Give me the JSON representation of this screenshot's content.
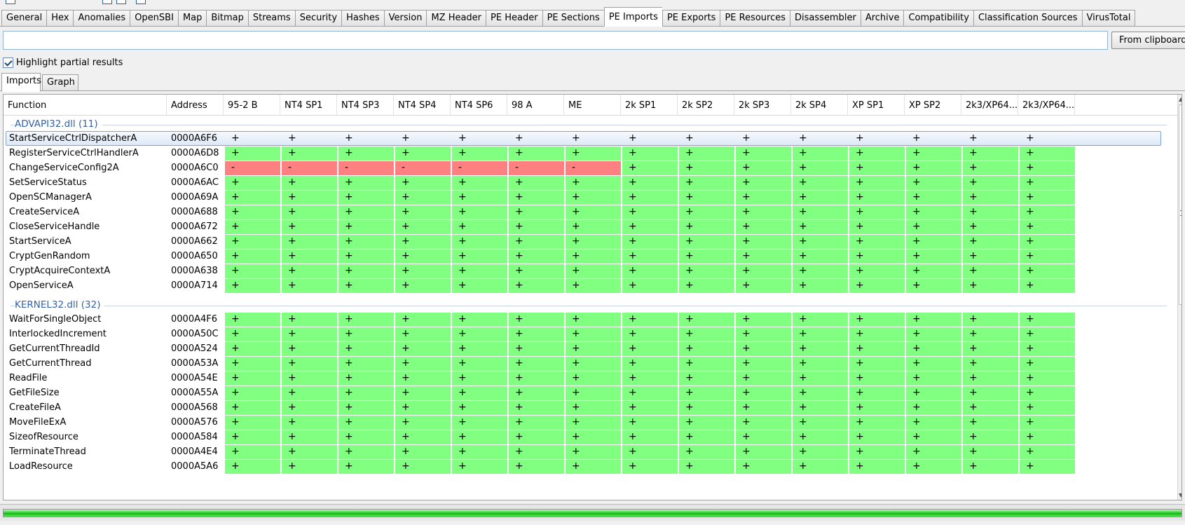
{
  "tabs": [
    {
      "label": "General",
      "active": false
    },
    {
      "label": "Hex",
      "active": false
    },
    {
      "label": "Anomalies",
      "active": false
    },
    {
      "label": "OpenSBI",
      "active": false
    },
    {
      "label": "Map",
      "active": false
    },
    {
      "label": "Bitmap",
      "active": false
    },
    {
      "label": "Streams",
      "active": false
    },
    {
      "label": "Security",
      "active": false
    },
    {
      "label": "Hashes",
      "active": false
    },
    {
      "label": "Version",
      "active": false
    },
    {
      "label": "MZ Header",
      "active": false
    },
    {
      "label": "PE Header",
      "active": false
    },
    {
      "label": "PE Sections",
      "active": false
    },
    {
      "label": "PE Imports",
      "active": true
    },
    {
      "label": "PE Exports",
      "active": false
    },
    {
      "label": "PE Resources",
      "active": false
    },
    {
      "label": "Disassembler",
      "active": false
    },
    {
      "label": "Archive",
      "active": false
    },
    {
      "label": "Compatibility",
      "active": false
    },
    {
      "label": "Classification Sources",
      "active": false
    },
    {
      "label": "VirusTotal",
      "active": false
    }
  ],
  "clipboard": {
    "value": "",
    "button_label": "From clipboard"
  },
  "highlight": {
    "label": "Highlight partial results",
    "checked": true
  },
  "subtabs": [
    {
      "label": "Imports",
      "active": true
    },
    {
      "label": "Graph",
      "active": false
    }
  ],
  "table": {
    "columns": [
      "Function",
      "Address",
      "95-2 B",
      "NT4 SP1",
      "NT4 SP3",
      "NT4 SP4",
      "NT4 SP6",
      "98 A",
      "ME",
      "2k SP1",
      "2k SP2",
      "2k SP3",
      "2k SP4",
      "XP SP1",
      "XP SP2",
      "2k3/XP64...",
      "2k3/XP64..."
    ],
    "groups": [
      {
        "label": "ADVAPI32.dll (11)",
        "rows": [
          {
            "function": "StartServiceCtrlDispatcherA",
            "address": "0000A6F6",
            "selected": true,
            "pattern": "all_plus"
          },
          {
            "function": "RegisterServiceCtrlHandlerA",
            "address": "0000A6D8",
            "pattern": "all_plus"
          },
          {
            "function": "ChangeServiceConfig2A",
            "address": "0000A6C0",
            "pattern": "minus_first7"
          },
          {
            "function": "SetServiceStatus",
            "address": "0000A6AC",
            "pattern": "all_plus"
          },
          {
            "function": "OpenSCManagerA",
            "address": "0000A69A",
            "pattern": "all_plus"
          },
          {
            "function": "CreateServiceA",
            "address": "0000A688",
            "pattern": "all_plus"
          },
          {
            "function": "CloseServiceHandle",
            "address": "0000A672",
            "pattern": "all_plus"
          },
          {
            "function": "StartServiceA",
            "address": "0000A662",
            "pattern": "all_plus"
          },
          {
            "function": "CryptGenRandom",
            "address": "0000A650",
            "pattern": "all_plus"
          },
          {
            "function": "CryptAcquireContextA",
            "address": "0000A638",
            "pattern": "all_plus"
          },
          {
            "function": "OpenServiceA",
            "address": "0000A714",
            "pattern": "all_plus"
          }
        ]
      },
      {
        "label": "KERNEL32.dll (32)",
        "rows": [
          {
            "function": "WaitForSingleObject",
            "address": "0000A4F6",
            "pattern": "all_plus"
          },
          {
            "function": "InterlockedIncrement",
            "address": "0000A50C",
            "pattern": "all_plus"
          },
          {
            "function": "GetCurrentThreadId",
            "address": "0000A524",
            "pattern": "all_plus"
          },
          {
            "function": "GetCurrentThread",
            "address": "0000A53A",
            "pattern": "all_plus"
          },
          {
            "function": "ReadFile",
            "address": "0000A54E",
            "pattern": "all_plus"
          },
          {
            "function": "GetFileSize",
            "address": "0000A55A",
            "pattern": "all_plus"
          },
          {
            "function": "CreateFileA",
            "address": "0000A568",
            "pattern": "all_plus"
          },
          {
            "function": "MoveFileExA",
            "address": "0000A576",
            "pattern": "all_plus"
          },
          {
            "function": "SizeofResource",
            "address": "0000A584",
            "pattern": "all_plus"
          },
          {
            "function": "TerminateThread",
            "address": "0000A4E4",
            "pattern": "all_plus"
          },
          {
            "function": "LoadResource",
            "address": "0000A5A6",
            "pattern": "all_plus"
          }
        ]
      }
    ],
    "marks": {
      "supported": "+",
      "unsupported": "-"
    }
  },
  "colors": {
    "supported": "#80ff80",
    "unsupported": "#ff8080",
    "group_label": "#3363ae",
    "accent": "#7ea2d7"
  },
  "progress": {
    "fraction": 1.0
  }
}
